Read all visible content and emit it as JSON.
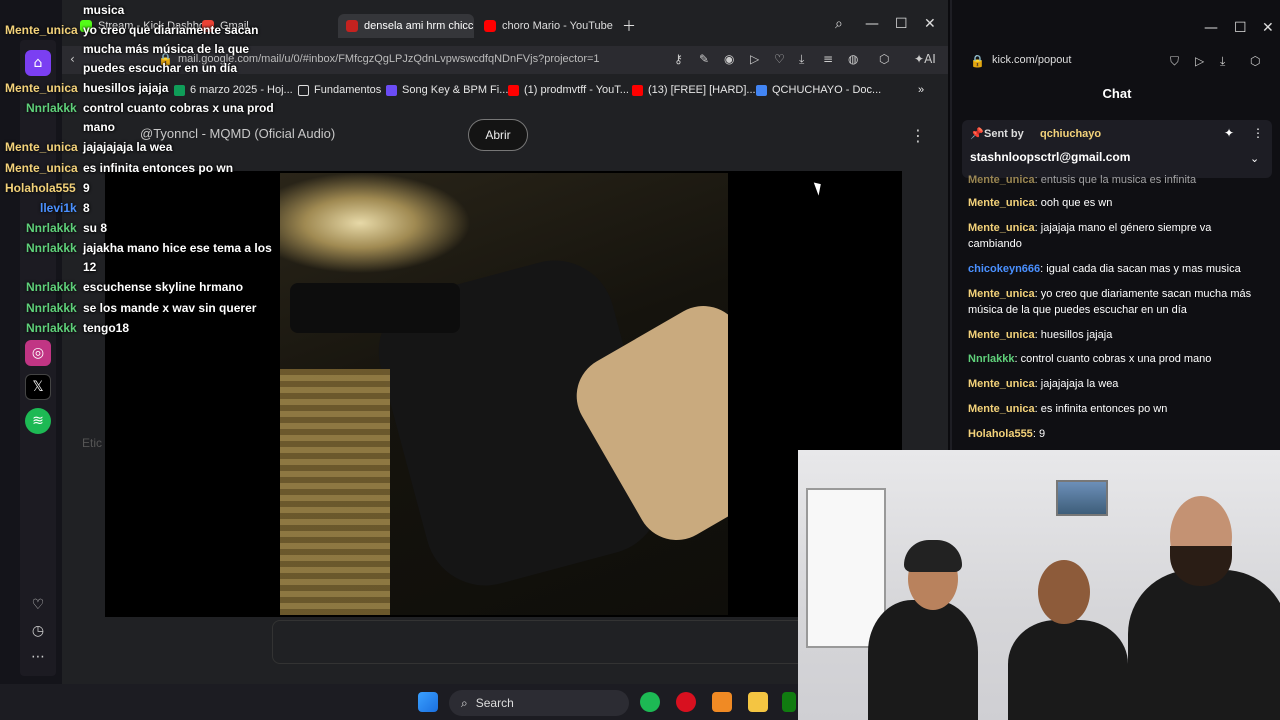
{
  "browser": {
    "tabs": [
      {
        "label": "Stream - Kick Dashbo..."
      },
      {
        "label": "Gmail"
      },
      {
        "label": "densela ami hrm chicc"
      },
      {
        "label": "choro Mario - YouTube"
      }
    ],
    "url": "mail.google.com/mail/u/0/#inbox/FMfcgzQgLPJzQdnLvpwswcdfqNDnFVjs?projector=1",
    "ai_label": "AI",
    "bookmarks": [
      {
        "label": "6 marzo 2025 - Hoj..."
      },
      {
        "label": "Fundamentos"
      },
      {
        "label": "Song Key & BPM Fi..."
      },
      {
        "label": "(1) prodmvtff - YouT..."
      },
      {
        "label": "(13) [FREE] [HARD]..."
      },
      {
        "label": "QCHUCHAYO - Doc..."
      }
    ],
    "video_title": "@Tyonncl - MQMD (Oficial Audio)",
    "open_button": "Abrir",
    "etic_label": "Etic"
  },
  "overlay_chat": [
    {
      "user": "",
      "text": "musica"
    },
    {
      "user": "Mente_unica",
      "text": "yo creo que diariamente sacan"
    },
    {
      "user": "",
      "text": "mucha más música de la que"
    },
    {
      "user": "",
      "text": "puedes escuchar en un día"
    },
    {
      "user": "Mente_unica",
      "text": "huesillos jajaja"
    },
    {
      "user": "Nnrlakkk",
      "text": "control cuanto cobras x una prod"
    },
    {
      "user": "",
      "text": "mano"
    },
    {
      "user": "Mente_unica",
      "text": "jajajajaja la wea"
    },
    {
      "user": "Mente_unica",
      "text": "es infinita entonces po wn"
    },
    {
      "user": "Holahola555",
      "text": "9"
    },
    {
      "user": "llevi1k",
      "text": "8"
    },
    {
      "user": "Nnrlakkk",
      "text": "su 8"
    },
    {
      "user": "Nnrlakkk",
      "text": "jajakha mano hice ese tema a los"
    },
    {
      "user": "",
      "text": "12"
    },
    {
      "user": "Nnrlakkk",
      "text": "escuchense skyline hrmano"
    },
    {
      "user": "Nnrlakkk",
      "text": "se los mande x wav sin querer"
    },
    {
      "user": "Nnrlakkk",
      "text": "tengo18"
    }
  ],
  "chat_panel": {
    "url": "kick.com/popout",
    "title": "Chat",
    "pinned_sent_by": "Sent by",
    "pinned_user": "qchiuchayo",
    "pinned_text": "stashnloopsctrl@gmail.com",
    "messages": [
      {
        "user": "Mente_unica",
        "text": "entusis que la musica es infinita",
        "color": "#f3d27a"
      },
      {
        "user": "Mente_unica",
        "text": "ooh que es wn",
        "color": "#f3d27a"
      },
      {
        "user": "Mente_unica",
        "text": "jajajaja mano el género siempre va cambiando",
        "color": "#f3d27a"
      },
      {
        "user": "chicokeyn666",
        "text": "igual cada dia sacan mas y mas musica",
        "color": "#4a90ff"
      },
      {
        "user": "Mente_unica",
        "text": "yo creo que diariamente sacan mucha más música de la que puedes escuchar en un día",
        "color": "#f3d27a"
      },
      {
        "user": "Mente_unica",
        "text": "huesillos jajaja",
        "color": "#f3d27a"
      },
      {
        "user": "Nnrlakkk",
        "text": "control cuanto cobras x una prod mano",
        "color": "#5fd07a"
      },
      {
        "user": "Mente_unica",
        "text": "jajajajaja la wea",
        "color": "#f3d27a"
      },
      {
        "user": "Mente_unica",
        "text": "es infinita entonces po wn",
        "color": "#f3d27a"
      },
      {
        "user": "Holahola555",
        "text": "9",
        "color": "#f3d27a"
      }
    ]
  },
  "taskbar": {
    "search_label": "Search"
  }
}
